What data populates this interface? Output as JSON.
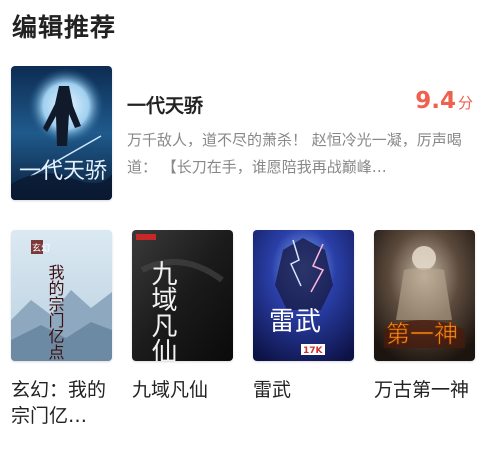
{
  "section": {
    "title": "编辑推荐"
  },
  "featured": {
    "title": "一代天骄",
    "score": "9.4",
    "score_unit": "分",
    "description": "万千敌人，道不尽的萧杀！ 赵恒冷光一凝，厉声喝道： 【长刀在手，谁愿陪我再战巅峰…",
    "cover_text": "一代天骄"
  },
  "books": [
    {
      "title": "玄幻：我的宗门亿…",
      "cover_text": "我的宗门亿点强",
      "cover_tag": "玄幻"
    },
    {
      "title": "九域凡仙",
      "cover_text": "九域凡仙"
    },
    {
      "title": "雷武",
      "cover_text": "雷武",
      "cover_badge": "17K"
    },
    {
      "title": "万古第一神",
      "cover_text": "第一神"
    }
  ],
  "colors": {
    "accent": "#f0604f",
    "title": "#222222",
    "desc": "#888888"
  }
}
